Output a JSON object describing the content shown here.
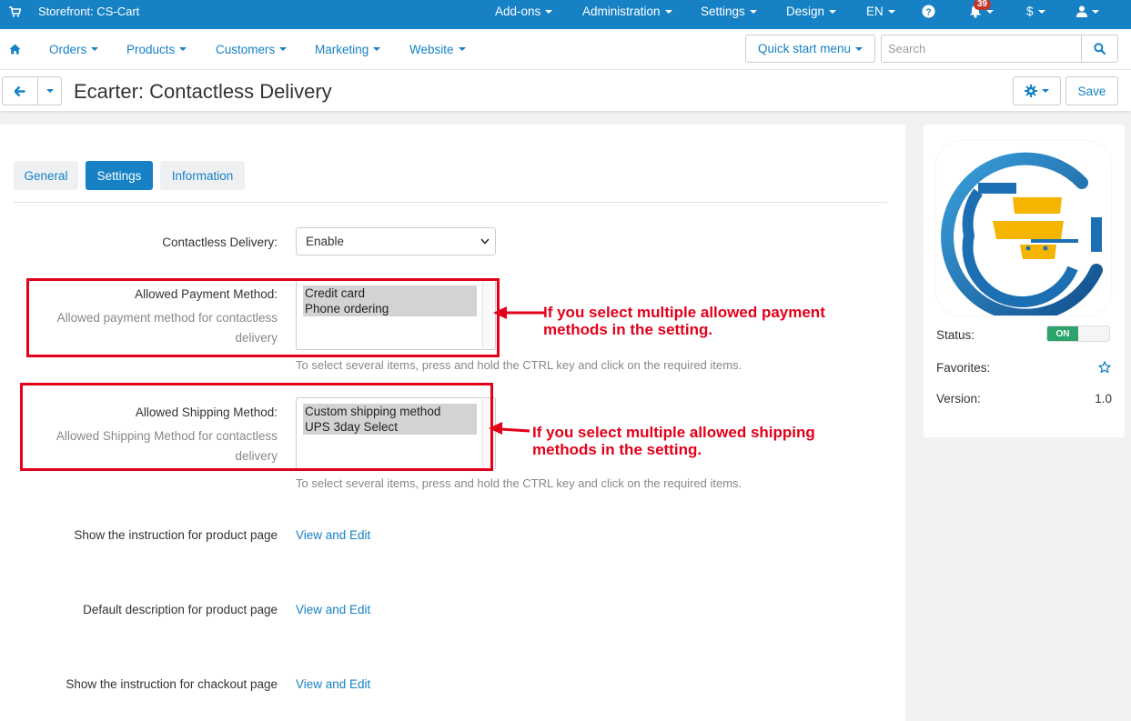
{
  "topbar": {
    "storefront": "Storefront: CS-Cart",
    "menus": [
      "Add-ons",
      "Administration",
      "Settings",
      "Design",
      "EN",
      "$"
    ],
    "notification_count": "39"
  },
  "nav": {
    "items": [
      "Orders",
      "Products",
      "Customers",
      "Marketing",
      "Website"
    ],
    "quick_start": "Quick start menu",
    "search_placeholder": "Search"
  },
  "titlebar": {
    "title": "Ecarter: Contactless Delivery",
    "save_label": "Save"
  },
  "tabs": [
    {
      "label": "General",
      "active": false
    },
    {
      "label": "Settings",
      "active": true
    },
    {
      "label": "Information",
      "active": false
    }
  ],
  "settings": {
    "contactless_label": "Contactless Delivery:",
    "contactless_value": "Enable",
    "payment_label": "Allowed Payment Method:",
    "payment_desc": "Allowed payment method for contactless delivery",
    "payment_options": [
      "Credit card",
      "Phone ordering"
    ],
    "shipping_label": "Allowed Shipping Method:",
    "shipping_desc": "Allowed Shipping Method for contactless delivery",
    "shipping_options": [
      "Custom shipping method",
      "UPS 3day Select"
    ],
    "multi_help": "To select several items, press and hold the CTRL key and click on the required items.",
    "instr_product_label": "Show the instruction for product page",
    "desc_product_label": "Default description for product page",
    "instr_checkout_label": "Show the instruction for chackout page",
    "view_edit": "View and Edit"
  },
  "annotations": {
    "payment": [
      "If you select multiple allowed payment",
      "methods in the setting."
    ],
    "shipping": [
      "If you select multiple allowed shipping",
      "methods in the setting."
    ]
  },
  "sidebar": {
    "status_label": "Status:",
    "status_value": "ON",
    "favorites_label": "Favorites:",
    "version_label": "Version:",
    "version_value": "1.0"
  },
  "colors": {
    "accent": "#1681c4",
    "annotation": "#e2001a",
    "status_on": "#2ba36b",
    "logo_blue": "#1e73b8",
    "logo_yellow": "#f5b400"
  }
}
